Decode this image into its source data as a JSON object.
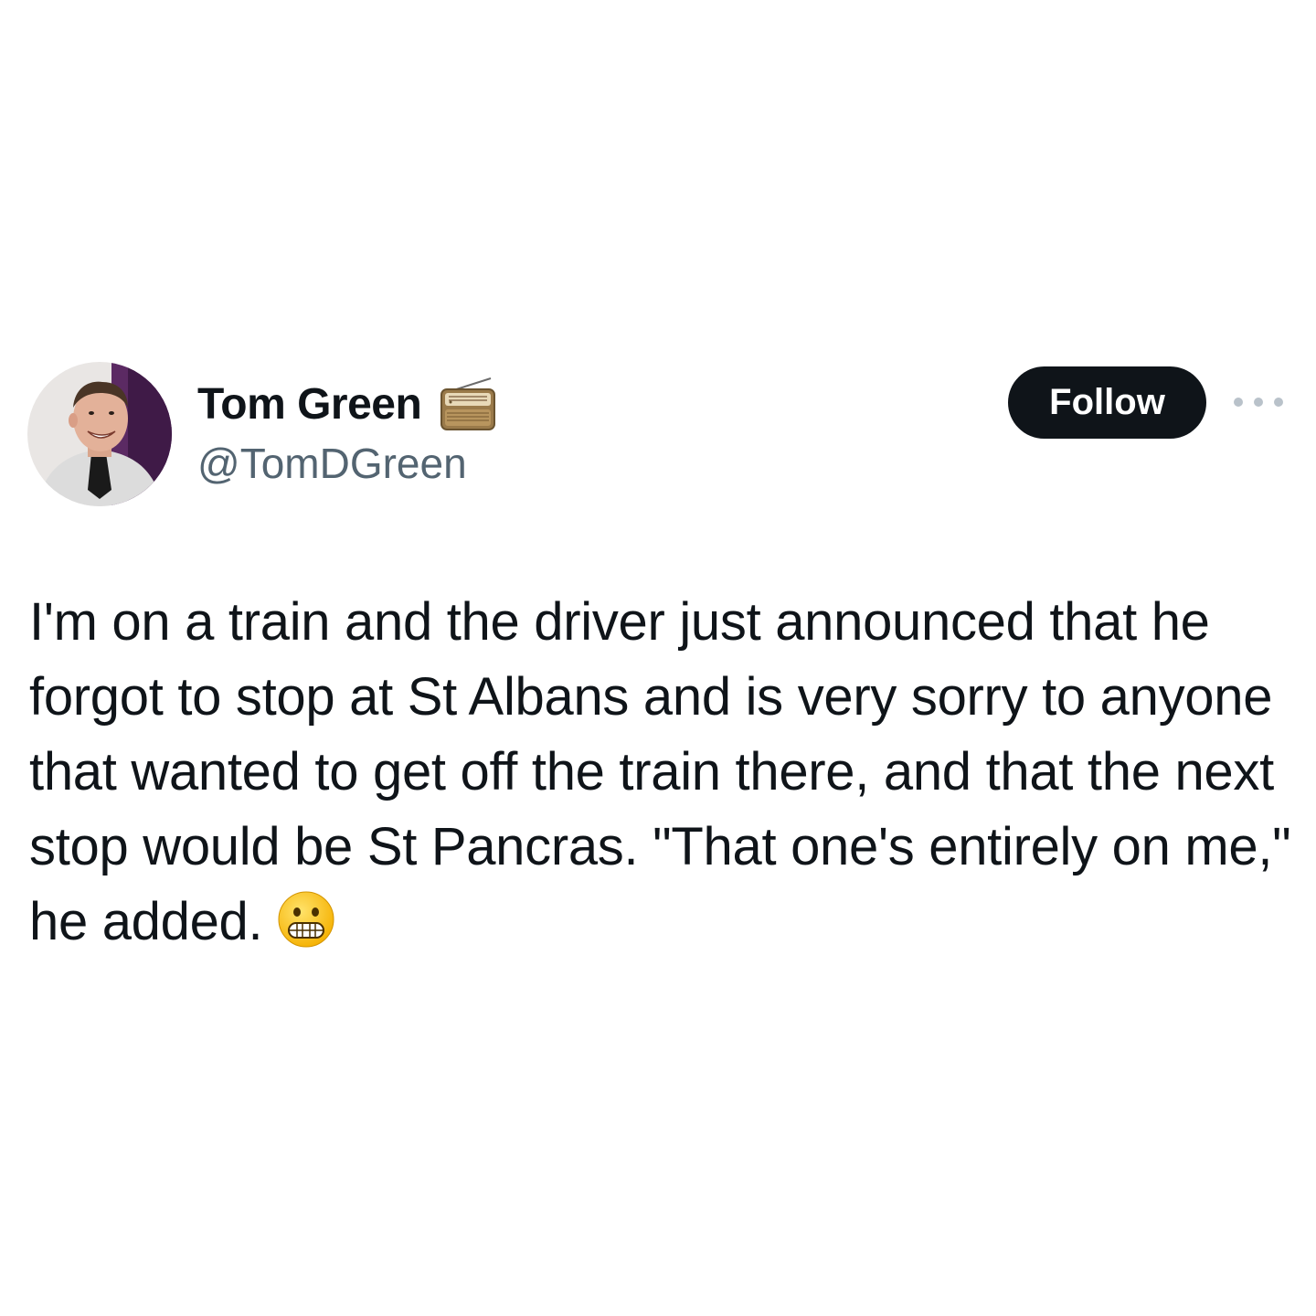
{
  "tweet": {
    "author": {
      "display_name": "Tom Green",
      "badge_icon": "radio-icon",
      "handle": "@TomDGreen",
      "avatar_icon": "profile-photo"
    },
    "follow_label": "Follow",
    "more_icon": "more-options-icon",
    "text": "I'm on a train and the driver just announced that he forgot to stop at St Albans and is very sorry to anyone that wanted to get off the train there, and that the next stop would be St Pancras. \"That one's entirely on me,\" he added.",
    "emoji": "grimacing-face-emoji"
  },
  "colors": {
    "text_primary": "#0f1419",
    "text_secondary": "#536471",
    "button_bg": "#0f1419",
    "button_text": "#ffffff",
    "background": "#ffffff"
  }
}
